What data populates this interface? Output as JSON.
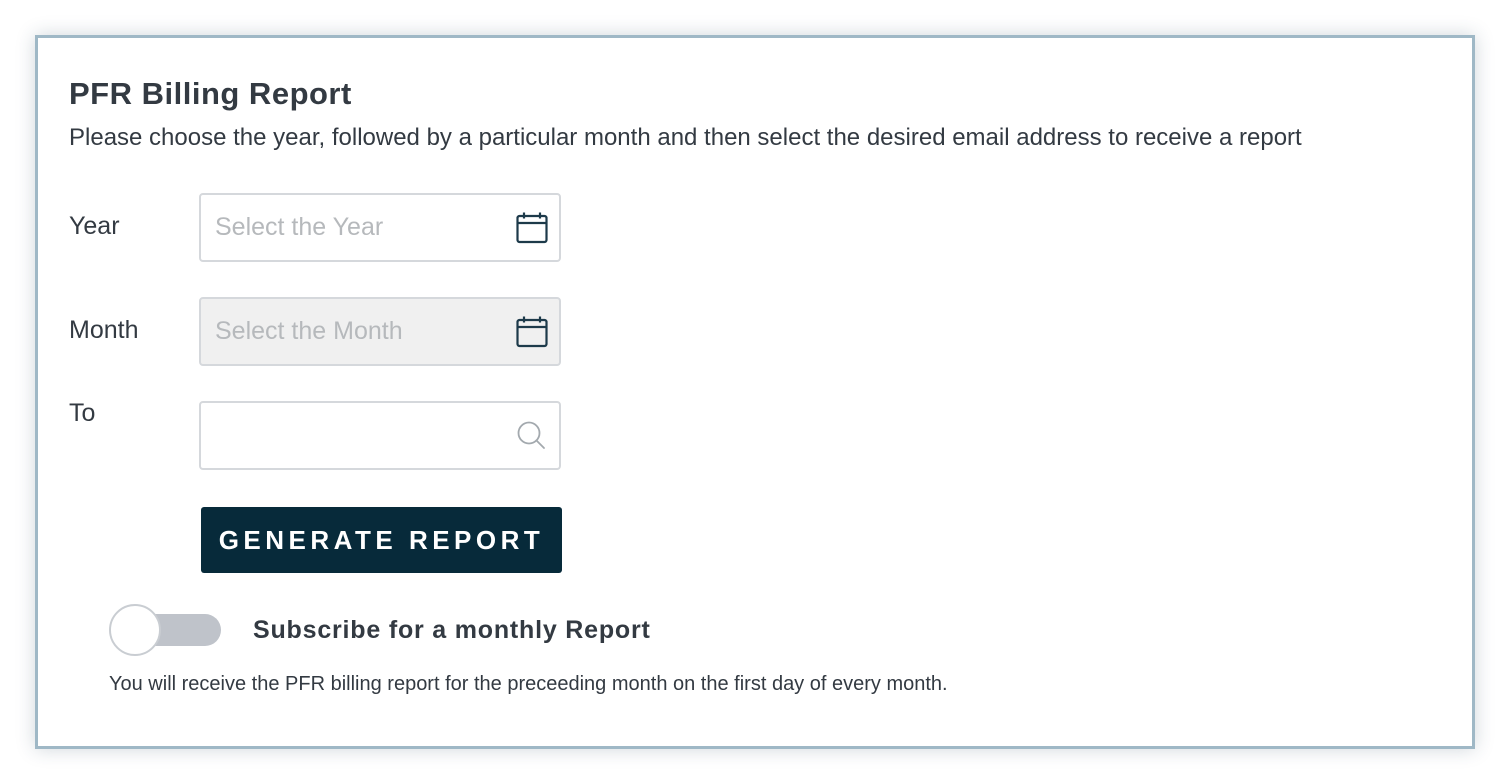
{
  "report": {
    "title": "PFR Billing Report",
    "description": "Please choose the year, followed by a particular month and then select the desired email address to receive a report"
  },
  "form": {
    "year": {
      "label": "Year",
      "placeholder": "Select the Year",
      "value": "",
      "icon": "calendar-icon"
    },
    "month": {
      "label": "Month",
      "placeholder": "Select the Month",
      "value": "",
      "disabled": true,
      "icon": "calendar-icon"
    },
    "to": {
      "label": "To",
      "placeholder": "",
      "value": "",
      "icon": "search-icon"
    },
    "generate_label": "GENERATE REPORT"
  },
  "subscription": {
    "label": "Subscribe for a monthly Report",
    "enabled": false,
    "note": "You will receive the PFR billing report for the preceeding month on the first day of every month."
  },
  "colors": {
    "button_bg": "#072a3a",
    "card_border": "#9fb8c6",
    "text": "#333a42",
    "toggle_track": "#bfc3ca",
    "disabled_field_bg": "#f0f0f0"
  }
}
